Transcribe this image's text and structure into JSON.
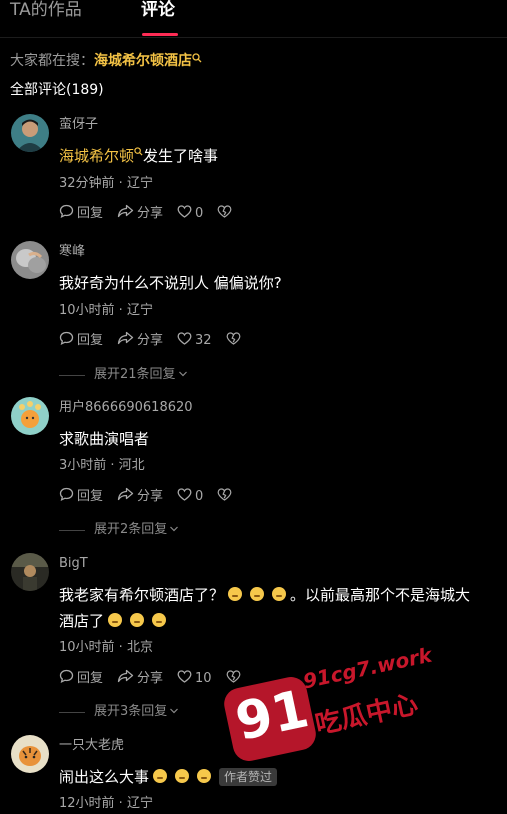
{
  "tabs": [
    {
      "label": "TA的作品"
    },
    {
      "label": "评论"
    }
  ],
  "search": {
    "prefix": "大家都在搜：",
    "term": "海城希尔顿酒店"
  },
  "comments_header": {
    "total_label": "全部评论(189)"
  },
  "actions": {
    "reply_label": "回复",
    "share_label": "分享"
  },
  "comments": [
    {
      "author": "蛮伢子",
      "content_highlight": "海城希尔顿",
      "content_rest": "发生了啥事",
      "meta": "32分钟前 · 辽宁",
      "likes": "0"
    },
    {
      "author": "寒峰",
      "content": "我好奇为什么不说别人 偏偏说你?",
      "meta": "10小时前 · 辽宁",
      "likes": "32",
      "expand": "展开21条回复"
    },
    {
      "author": "用户8666690618620",
      "content": "求歌曲演唱者",
      "meta": "3小时前 · 河北",
      "likes": "0",
      "expand": "展开2条回复"
    },
    {
      "author": "BigT",
      "content_part1": "我老家有希尔顿酒店了？",
      "content_part2": "。以前最高那个不是海城大",
      "content_line2": "酒店了",
      "meta": "10小时前 · 北京",
      "likes": "10",
      "expand": "展开3条回复"
    },
    {
      "author": "一只大老虎",
      "content": "闹出这么大事",
      "badge": "作者赞过",
      "meta": "12小时前 · 辽宁"
    }
  ],
  "watermark": {
    "number": "91",
    "url": "91cg7.work",
    "name": "吃瓜中心"
  },
  "colors": {
    "background": "#000000",
    "accent": "#fe2c55",
    "highlight": "#f3c245",
    "secondary_text": "#a8a8a8",
    "watermark": "#c8172b"
  },
  "icons": [
    "search-icon",
    "reply-icon",
    "share-icon",
    "heart-icon",
    "dislike-icon",
    "chevron-down-icon"
  ]
}
